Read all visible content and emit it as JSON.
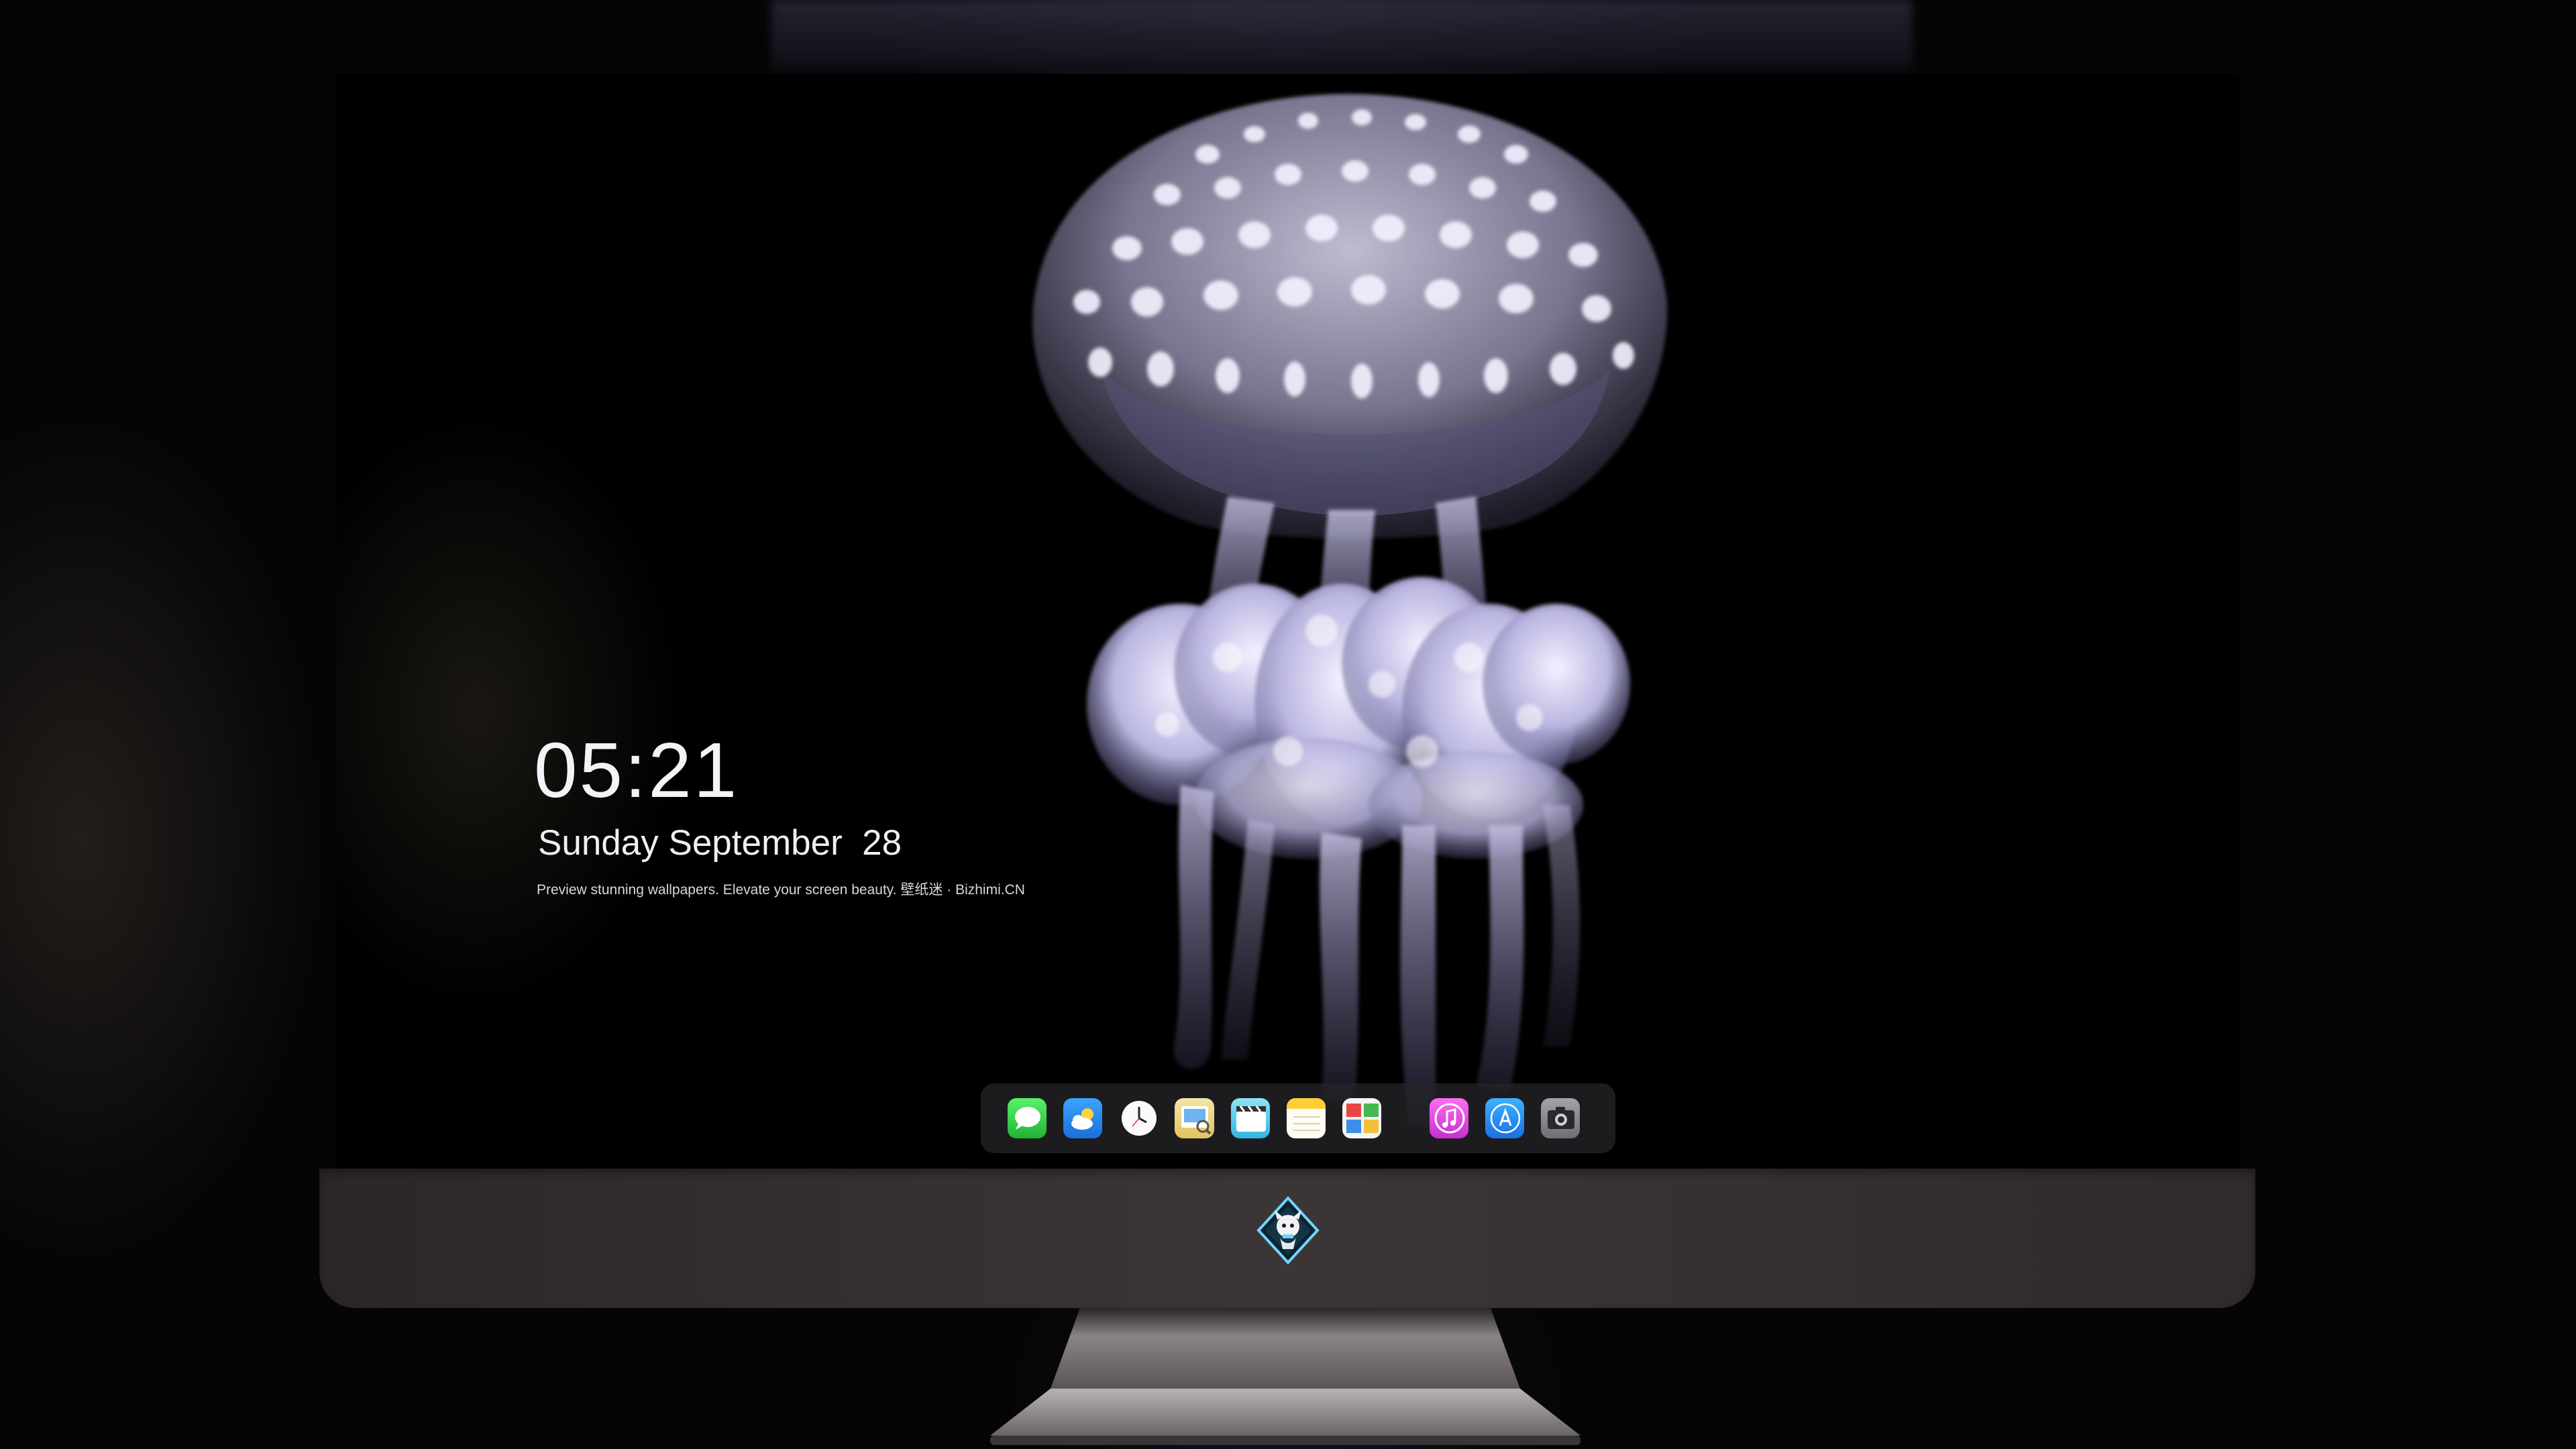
{
  "lockscreen": {
    "time": "05:21",
    "date": "Sunday September  28",
    "tagline": "Preview stunning wallpapers. Elevate your screen beauty. 壁纸迷 · Bizhimi.CN"
  },
  "dock": {
    "apps": [
      {
        "icon": "messages-icon",
        "color": "#2ecc40"
      },
      {
        "icon": "weather-icon",
        "color": "#2f8ef0"
      },
      {
        "icon": "clock-icon",
        "color": "#1c1c1e"
      },
      {
        "icon": "preview-icon",
        "color": "#e8d36a"
      },
      {
        "icon": "clips-icon",
        "color": "#36c2e8"
      },
      {
        "icon": "notes-icon",
        "color": "#ffd84a"
      },
      {
        "icon": "photo-booth-icon",
        "color": "#e04545"
      },
      {
        "icon": "music-icon",
        "color": "#e050d8"
      },
      {
        "icon": "app-store-icon",
        "color": "#2a8df2"
      },
      {
        "icon": "camera-icon",
        "color": "#8a8a8e"
      }
    ]
  },
  "chin": {
    "logo_icon": "mascot-logo-icon"
  },
  "colors": {
    "background": "#050507",
    "chin": "#3b3536",
    "dock": "#242428"
  }
}
